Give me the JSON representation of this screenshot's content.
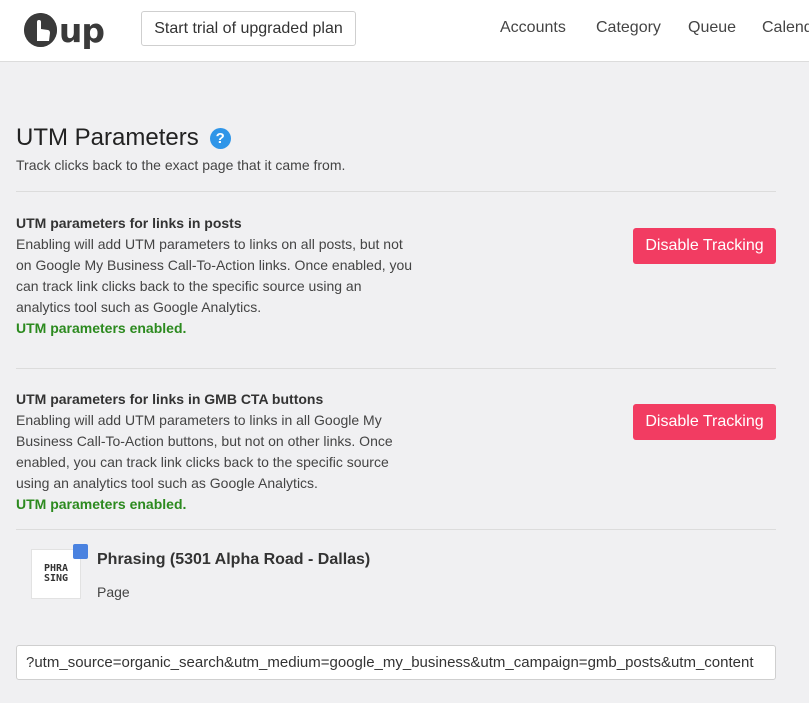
{
  "header": {
    "logo_text": "up",
    "trial_button": "Start trial of upgraded plan",
    "nav": [
      "Accounts",
      "Category",
      "Queue",
      "Calendar"
    ]
  },
  "page": {
    "title": "UTM Parameters",
    "help_icon": "?",
    "subtitle": "Track clicks back to the exact page that it came from."
  },
  "sections": [
    {
      "title": "UTM parameters for links in posts",
      "description": "Enabling will add UTM parameters to links on all posts, but not on Google My Business Call-To-Action links. Once enabled, you can track link clicks back to the specific source using an analytics tool such as Google Analytics.",
      "status": "UTM parameters enabled.",
      "button": "Disable Tracking"
    },
    {
      "title": "UTM parameters for links in GMB CTA buttons",
      "description": "Enabling will add UTM parameters to links in all Google My Business Call-To-Action buttons, but not on other links. Once enabled, you can track link clicks back to the specific source using an analytics tool such as Google Analytics.",
      "status": "UTM parameters enabled.",
      "button": "Disable Tracking"
    }
  ],
  "profile": {
    "thumb_text": "PHRA\nSING",
    "name": "Phrasing (5301 Alpha Road - Dallas)",
    "type": "Page"
  },
  "utm_input": {
    "value": "?utm_source=organic_search&utm_medium=google_my_business&utm_campaign=gmb_posts&utm_content"
  }
}
